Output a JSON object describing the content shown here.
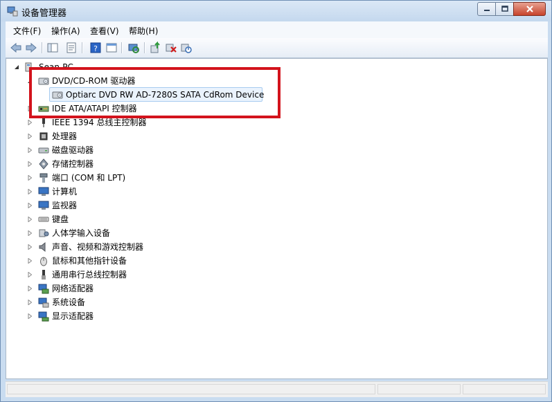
{
  "window": {
    "title": "设备管理器",
    "accent": "#c9dcf0",
    "highlight_color": "#d3131c"
  },
  "menu": {
    "items": [
      {
        "label": "文件(F)"
      },
      {
        "label": "操作(A)"
      },
      {
        "label": "查看(V)"
      },
      {
        "label": "帮助(H)"
      }
    ]
  },
  "toolbar": {
    "icons": [
      "back-icon",
      "forward-icon",
      "show-hide-tree-icon",
      "properties-icon",
      "help-icon",
      "view-icon",
      "scan-hardware-icon",
      "update-driver-icon",
      "uninstall-icon",
      "disable-icon"
    ]
  },
  "tree": {
    "root": {
      "label": "Sean-PC",
      "icon": "computer-icon"
    },
    "nodes": [
      {
        "label": "DVD/CD-ROM 驱动器",
        "icon": "dvd-drive-icon",
        "expanded": true
      },
      {
        "label": "Optiarc DVD RW AD-7280S SATA CdRom Device",
        "icon": "dvd-drive-icon",
        "child": true,
        "selected": true
      },
      {
        "label": "IDE ATA/ATAPI 控制器",
        "icon": "ide-controller-icon"
      },
      {
        "label": "IEEE 1394 总线主控制器",
        "icon": "ieee1394-icon"
      },
      {
        "label": "处理器",
        "icon": "processor-icon"
      },
      {
        "label": "磁盘驱动器",
        "icon": "disk-drive-icon"
      },
      {
        "label": "存储控制器",
        "icon": "storage-controller-icon"
      },
      {
        "label": "端口 (COM 和 LPT)",
        "icon": "port-icon"
      },
      {
        "label": "计算机",
        "icon": "computer-icon"
      },
      {
        "label": "监视器",
        "icon": "monitor-icon"
      },
      {
        "label": "键盘",
        "icon": "keyboard-icon"
      },
      {
        "label": "人体学输入设备",
        "icon": "hid-icon"
      },
      {
        "label": "声音、视频和游戏控制器",
        "icon": "sound-icon"
      },
      {
        "label": "鼠标和其他指针设备",
        "icon": "mouse-icon"
      },
      {
        "label": "通用串行总线控制器",
        "icon": "usb-icon"
      },
      {
        "label": "网络适配器",
        "icon": "network-adapter-icon"
      },
      {
        "label": "系统设备",
        "icon": "system-device-icon"
      },
      {
        "label": "显示适配器",
        "icon": "display-adapter-icon"
      }
    ]
  }
}
